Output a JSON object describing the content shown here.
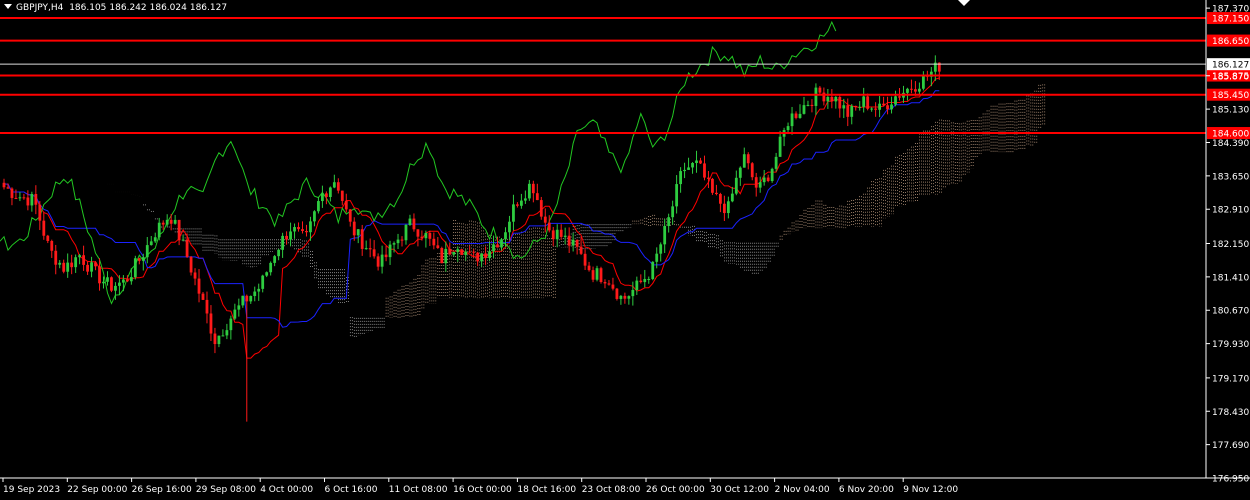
{
  "header": {
    "symbol_tf": "GBPJPY,H4",
    "open": "186.105",
    "high": "186.242",
    "low": "186.024",
    "close": "186.127"
  },
  "colors": {
    "background": "#000000",
    "bull": "#2ecc40",
    "bear": "#ff1a1a",
    "tenkan": "#ff0000",
    "kijun": "#1b22ff",
    "chikou": "#22c822",
    "cloud_bull": "#f5c9a6",
    "cloud_bear": "#d8d8d8",
    "level_line": "#ff0000",
    "axis_text": "#ffffff"
  },
  "chart_data": {
    "type": "candlestick",
    "symbol": "GBPJPY",
    "timeframe": "H4",
    "ylim": [
      176.95,
      187.55
    ],
    "y_ticks": [
      "187.370",
      "186.650",
      "186.127",
      "185.870",
      "185.130",
      "184.390",
      "183.650",
      "182.910",
      "182.150",
      "181.410",
      "180.670",
      "179.930",
      "179.170",
      "178.430",
      "177.690",
      "176.950"
    ],
    "x_ticks": [
      "19 Sep 2023",
      "22 Sep 00:00",
      "26 Sep 16:00",
      "29 Sep 08:00",
      "4 Oct 00:00",
      "6 Oct 16:00",
      "11 Oct 08:00",
      "16 Oct 00:00",
      "18 Oct 16:00",
      "23 Oct 08:00",
      "26 Oct 00:00",
      "30 Oct 12:00",
      "2 Nov 04:00",
      "6 Nov 20:00",
      "9 Nov 12:00"
    ],
    "levels": [
      {
        "price": 187.15,
        "label": "187.150"
      },
      {
        "price": 186.65,
        "label": "186.650"
      },
      {
        "price": 185.875,
        "label": "185.875"
      },
      {
        "price": 185.45,
        "label": "185.450"
      },
      {
        "price": 184.6,
        "label": "184.600"
      }
    ],
    "current_price": {
      "price": 186.127,
      "label": "186.127"
    },
    "ohlc_waypoints_close": [
      183.4,
      183.2,
      183.1,
      182.0,
      181.6,
      181.9,
      181.5,
      181.2,
      181.3,
      181.8,
      182.4,
      182.8,
      182.0,
      181.0,
      180.0,
      180.5,
      180.9,
      181.2,
      182.0,
      182.5,
      182.2,
      183.2,
      183.6,
      182.5,
      182.1,
      181.7,
      182.2,
      182.6,
      182.3,
      181.8,
      182.2,
      181.8,
      182.0,
      182.3,
      183.1,
      183.5,
      182.5,
      182.3,
      182.0,
      181.5,
      181.4,
      180.9,
      181.2,
      181.6,
      182.6,
      183.8,
      183.9,
      183.2,
      182.9,
      184.1,
      183.3,
      183.9,
      184.9,
      185.2,
      185.5,
      185.4,
      185.0,
      185.3,
      185.1,
      185.4,
      185.6,
      185.8,
      186.1
    ],
    "indicators": [
      "Ichimoku Kinko Hyo (Tenkan-sen, Kijun-sen, Chikou Span, Kumo)"
    ]
  }
}
